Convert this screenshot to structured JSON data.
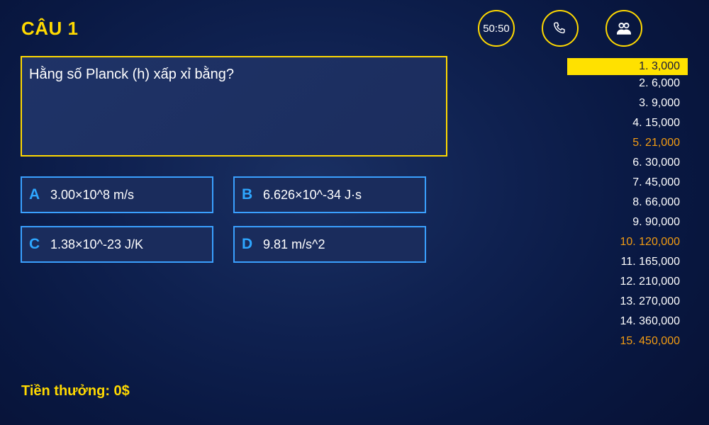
{
  "question": {
    "number_label": "CÂU 1",
    "text": "Hằng số Planck (h) xấp xỉ bằng?"
  },
  "lifelines": {
    "fifty_fifty": "50:50",
    "phone_icon": "phone-icon",
    "audience_icon": "audience-icon"
  },
  "answers": [
    {
      "letter": "A",
      "text": "3.00×10^8 m/s"
    },
    {
      "letter": "B",
      "text": "6.626×10^-34 J·s"
    },
    {
      "letter": "C",
      "text": "1.38×10^-23 J/K"
    },
    {
      "letter": "D",
      "text": "9.81 m/s^2"
    }
  ],
  "prize_ladder": [
    {
      "label": "1. 3,000",
      "state": "current"
    },
    {
      "label": "2. 6,000",
      "state": "normal"
    },
    {
      "label": "3. 9,000",
      "state": "normal"
    },
    {
      "label": "4. 15,000",
      "state": "normal"
    },
    {
      "label": "5. 21,000",
      "state": "milestone"
    },
    {
      "label": "6. 30,000",
      "state": "normal"
    },
    {
      "label": "7. 45,000",
      "state": "normal"
    },
    {
      "label": "8. 66,000",
      "state": "normal"
    },
    {
      "label": "9. 90,000",
      "state": "normal"
    },
    {
      "label": "10. 120,000",
      "state": "milestone"
    },
    {
      "label": "11. 165,000",
      "state": "normal"
    },
    {
      "label": "12. 210,000",
      "state": "normal"
    },
    {
      "label": "13. 270,000",
      "state": "normal"
    },
    {
      "label": "14. 360,000",
      "state": "normal"
    },
    {
      "label": "15. 450,000",
      "state": "milestone"
    }
  ],
  "prize": {
    "label": "Tiền thưởng: 0$"
  },
  "colors": {
    "accent_yellow": "#ffd900",
    "answer_border": "#3aa0ff",
    "milestone": "#f39c12",
    "background": "#0f2150"
  }
}
